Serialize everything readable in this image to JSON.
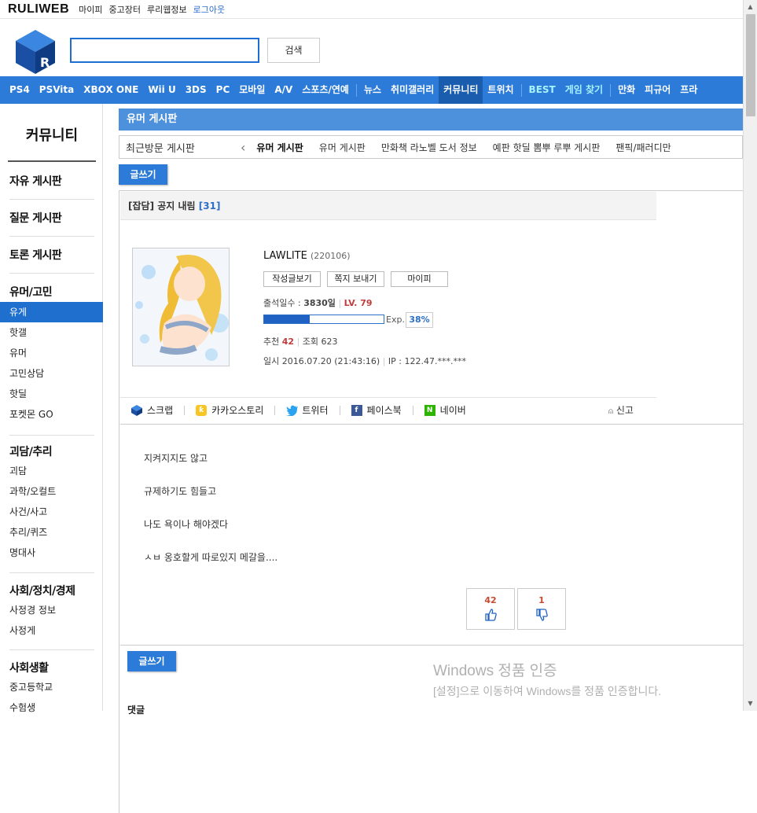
{
  "topbar": {
    "brand": "RULIWEB",
    "links": [
      "마이피",
      "중고장터",
      "루리웹정보"
    ],
    "logout": "로그아웃"
  },
  "header": {
    "search_placeholder": "",
    "search_button": "검색"
  },
  "nav": {
    "items": [
      "PS4",
      "PSVita",
      "XBOX ONE",
      "Wii U",
      "3DS",
      "PC",
      "모바일",
      "A/V",
      "스포츠/연예",
      "뉴스",
      "취미갤러리",
      "커뮤니티",
      "트위치",
      "BEST",
      "게임 찾기",
      "만화",
      "피규어",
      "프라"
    ]
  },
  "sidebar": {
    "title": "커뮤니티",
    "mains": [
      "자유 게시판",
      "질문 게시판",
      "토론 게시판"
    ],
    "group1": {
      "title": "유머/고민",
      "items": [
        "유게",
        "핫갤",
        "유머",
        "고민상담",
        "핫딜",
        "포켓몬 GO"
      ]
    },
    "group2": {
      "title": "괴담/추리",
      "items": [
        "괴담",
        "과학/오컬트",
        "사건/사고",
        "추리/퀴즈",
        "명대사"
      ]
    },
    "group3": {
      "title": "사회/정치/경제",
      "items": [
        "사정경 정보",
        "사정게"
      ]
    },
    "group4": {
      "title": "사회생활",
      "items": [
        "중고등학교",
        "수험생"
      ]
    }
  },
  "board": {
    "title": "유머 게시판",
    "recent_label": "최근방문 게시판",
    "recent_items": [
      "유머 게시판",
      "유머 게시판",
      "만화책 라노벨 도서 정보",
      "예판 핫딜 뽐뿌 루뿌 게시판",
      "팬픽/패러디만"
    ],
    "write_label": "글쓰기"
  },
  "post": {
    "title": "[잡담] 공지 내림",
    "comment_count": "[31]",
    "author": {
      "name": "LAWLITE",
      "id": "(220106)",
      "btn_posts": "작성글보기",
      "btn_message": "쪽지 보내기",
      "btn_mypi": "마이피",
      "attendance_label": "출석일수 : ",
      "attendance_value": "3830일",
      "level": "LV. 79",
      "exp_label": "Exp.",
      "exp_percent": "38%",
      "exp_fraction": 0.38,
      "recommend_label": "추천",
      "recommend_value": "42",
      "views_label": "조회",
      "views_value": "623",
      "date_text": "일시 2016.07.20 (21:43:16)",
      "ip_text": "IP : 122.47.***.***"
    },
    "share": [
      "스크랩",
      "카카오스토리",
      "트위터",
      "페이스북",
      "네이버"
    ],
    "report": "신고",
    "lines": [
      "지켜지지도 않고",
      "규제하기도 힘들고",
      "나도 욕이나 해야겠다",
      "ㅅㅂ 옹호할게 따로있지 메갈을...."
    ],
    "upvotes": "42",
    "downvotes": "1"
  },
  "comments_label": "댓글",
  "watermark": {
    "line1": "Windows 정품 인증",
    "line2": "[설정]으로 이동하여 Windows를 정품 인증합니다."
  },
  "colors": {
    "nav_blue": "#2c7bd8",
    "active_blue": "#1a5cad",
    "accent_red": "#c23c3c"
  }
}
